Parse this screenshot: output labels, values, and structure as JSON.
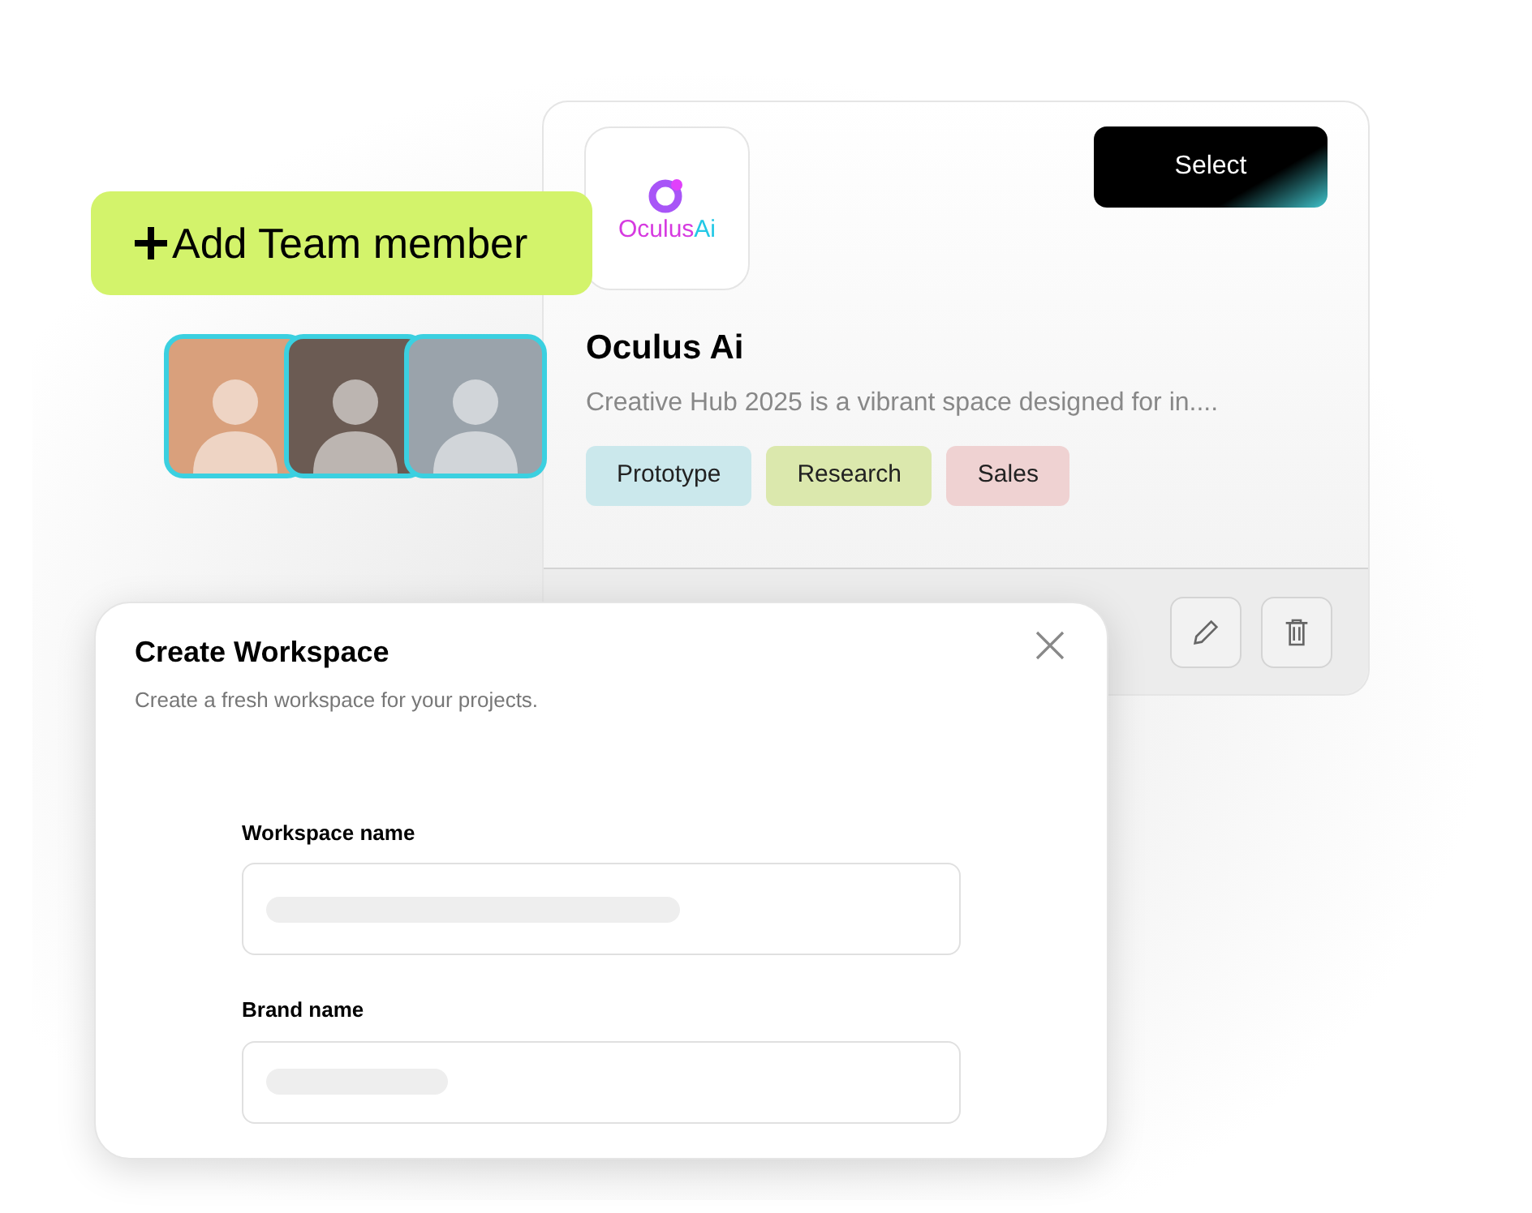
{
  "add_member_button": {
    "label": "Add Team member"
  },
  "team_avatars": [
    {
      "color": "#d9a07c"
    },
    {
      "color": "#6b5b53"
    },
    {
      "color": "#9aa3ab"
    }
  ],
  "project_card": {
    "logo_words": [
      {
        "text": "Oculus",
        "color": "#d63ae0"
      },
      {
        "text": "Ai",
        "color": "#22c8e6"
      }
    ],
    "select_button": "Select",
    "title": "Oculus Ai",
    "description": "Creative Hub 2025 is a vibrant space designed for in....",
    "tags": [
      {
        "label": "Prototype",
        "color": "#cbe8ec"
      },
      {
        "label": "Research",
        "color": "#dbe8ad"
      },
      {
        "label": "Sales",
        "color": "#efd2d2"
      }
    ]
  },
  "create_workspace": {
    "title": "Create Workspace",
    "subtitle": "Create a fresh workspace for your projects.",
    "fields": [
      {
        "label": "Workspace name"
      },
      {
        "label": "Brand name"
      }
    ]
  }
}
